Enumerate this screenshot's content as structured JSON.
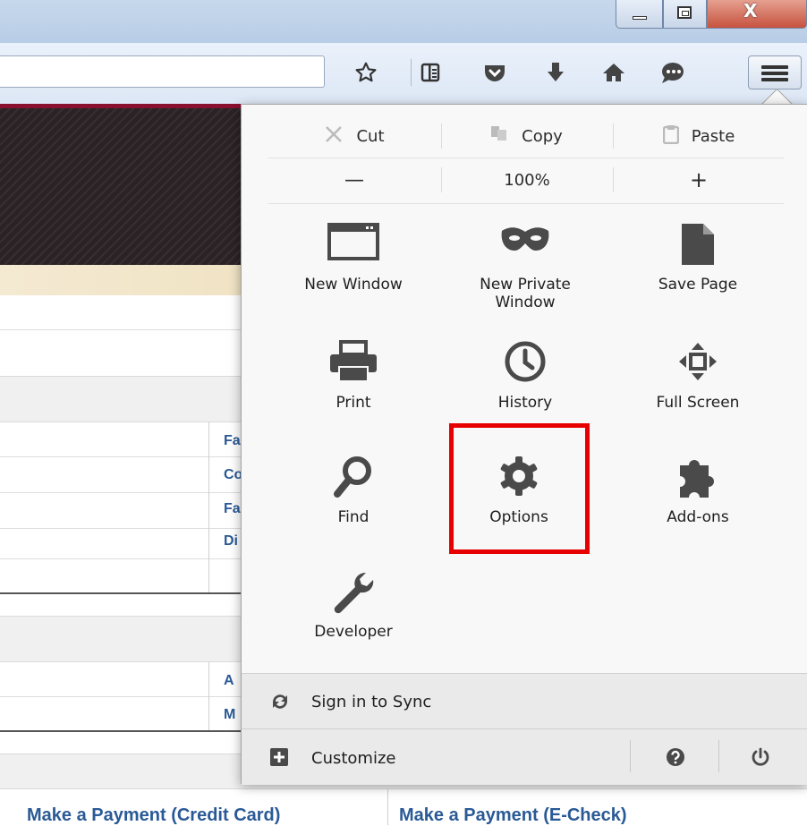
{
  "window_controls": {
    "minimize": "minimize-icon",
    "maximize": "maximize-icon",
    "close_glyph": "X"
  },
  "toolbar": {
    "icons": [
      "bookmark-star-icon",
      "reading-list-icon",
      "pocket-icon",
      "download-icon",
      "home-icon",
      "chat-icon",
      "menu-icon"
    ]
  },
  "page_behind": {
    "peek_letters": [
      "Fa",
      "Co",
      "Fa",
      "Di",
      "A",
      "M"
    ],
    "links": [
      "Make a Payment (Credit Card)",
      "Make a Payment (E-Check)"
    ]
  },
  "menu": {
    "edit": {
      "cut": "Cut",
      "copy": "Copy",
      "paste": "Paste"
    },
    "zoom": {
      "out": "—",
      "level": "100%",
      "in": "+"
    },
    "items": [
      {
        "label": "New Window",
        "icon": "new-window-icon"
      },
      {
        "label": "New Private Window",
        "icon": "private-mask-icon"
      },
      {
        "label": "Save Page",
        "icon": "save-page-icon"
      },
      {
        "label": "Print",
        "icon": "printer-icon"
      },
      {
        "label": "History",
        "icon": "clock-icon"
      },
      {
        "label": "Full Screen",
        "icon": "full-screen-icon"
      },
      {
        "label": "Find",
        "icon": "magnifier-icon"
      },
      {
        "label": "Options",
        "icon": "gear-icon"
      },
      {
        "label": "Add-ons",
        "icon": "puzzle-icon"
      },
      {
        "label": "Developer",
        "icon": "wrench-icon"
      }
    ],
    "sync_label": "Sign in to Sync",
    "customize_label": "Customize",
    "highlight_color": "#e60000"
  }
}
